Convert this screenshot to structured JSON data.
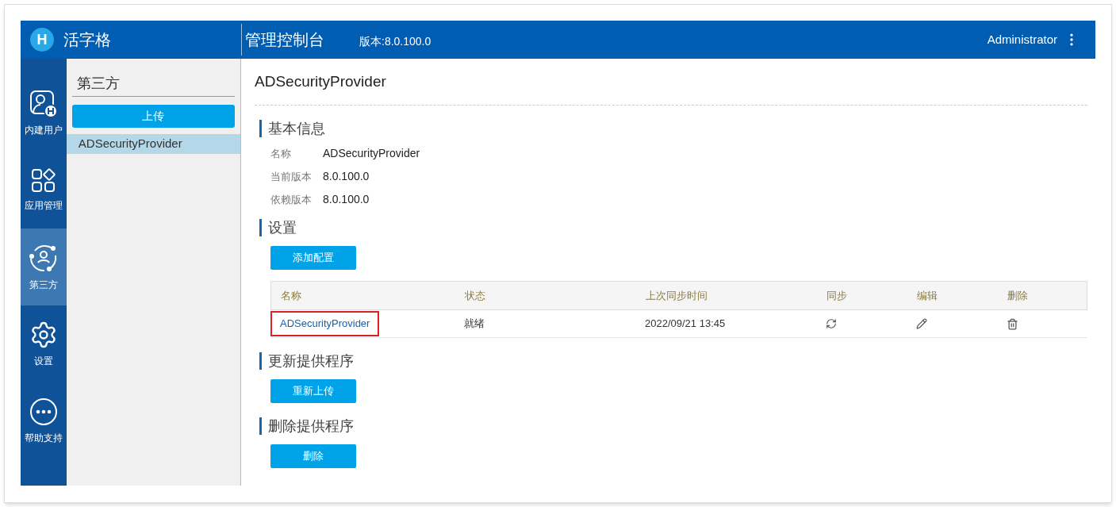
{
  "header": {
    "logo_letter": "H",
    "brand": "活字格",
    "title": "管理控制台",
    "version": "版本:8.0.100.0",
    "user": "Administrator"
  },
  "nav": [
    {
      "kind": "users",
      "label": "内建用户",
      "selected": false
    },
    {
      "kind": "apps",
      "label": "应用管理",
      "selected": false
    },
    {
      "kind": "thirdparty",
      "label": "第三方",
      "selected": true
    },
    {
      "kind": "settings",
      "label": "设置",
      "selected": false
    },
    {
      "kind": "help",
      "label": "帮助支持",
      "selected": false
    }
  ],
  "panel": {
    "title": "第三方",
    "upload_button": "上传",
    "items": [
      {
        "label": "ADSecurityProvider",
        "selected": true
      }
    ]
  },
  "main": {
    "title": "ADSecurityProvider",
    "basic": {
      "heading": "基本信息",
      "fields": [
        {
          "label": "名称",
          "value": "ADSecurityProvider"
        },
        {
          "label": "当前版本",
          "value": "8.0.100.0"
        },
        {
          "label": "依赖版本",
          "value": "8.0.100.0"
        }
      ]
    },
    "settings": {
      "heading": "设置",
      "add_button": "添加配置",
      "columns": [
        "名称",
        "状态",
        "上次同步时间",
        "同步",
        "编辑",
        "删除"
      ],
      "rows": [
        {
          "name": "ADSecurityProvider",
          "highlighted": true,
          "status": "就绪",
          "last_sync": "2022/09/21 13:45"
        }
      ]
    },
    "update": {
      "heading": "更新提供程序",
      "button": "重新上传"
    },
    "remove": {
      "heading": "删除提供程序",
      "button": "删除"
    }
  }
}
